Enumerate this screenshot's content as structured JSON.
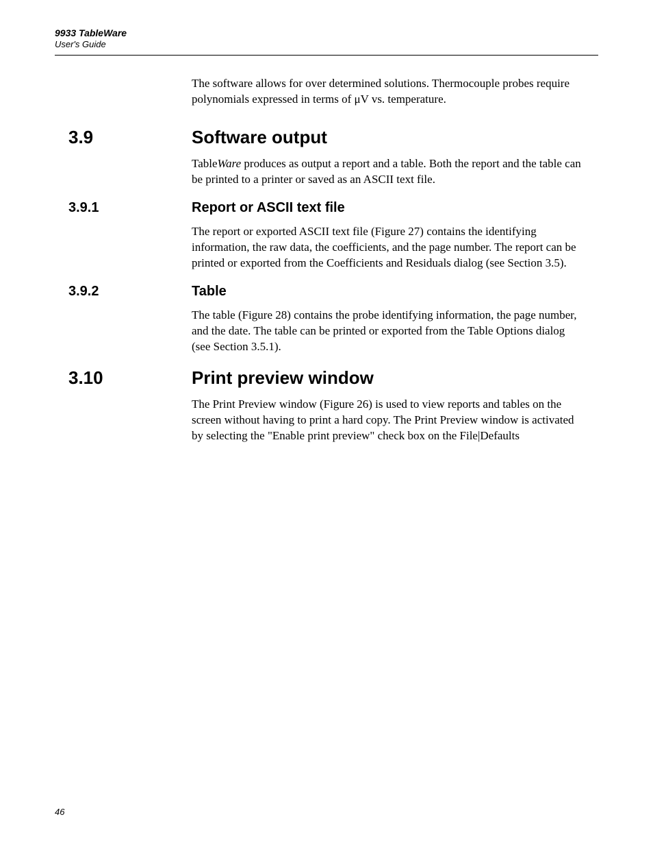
{
  "header": {
    "product": "9933 TableWare",
    "doctype": "User's Guide"
  },
  "intro": "The software allows for over determined solutions. Thermocouple probes require polynomials expressed in terms of μV vs. temperature.",
  "sections": {
    "s39": {
      "num": "3.9",
      "title": "Software output",
      "body_prefix": "Table",
      "body_italic": "Ware",
      "body_suffix": " produces as output a report and a table. Both the report and the table can be printed to a printer or saved as an ASCII text file."
    },
    "s391": {
      "num": "3.9.1",
      "title": "Report or ASCII text file",
      "body": "The report or exported ASCII text file (Figure 27) contains the identifying information, the raw data, the coefficients, and the page number. The report can be printed or exported from the Coefficients and Residuals dialog (see Section 3.5)."
    },
    "s392": {
      "num": "3.9.2",
      "title": "Table",
      "body": "The table (Figure 28) contains the probe identifying information, the page number, and the date. The table can be printed or exported from the Table Options dialog (see Section 3.5.1)."
    },
    "s310": {
      "num": "3.10",
      "title": "Print preview window",
      "body": "The Print Preview window (Figure 26) is used to view reports and tables on the screen without having to print a hard copy. The Print Preview window is activated by selecting the \"Enable print preview\" check box on the File|Defaults"
    }
  },
  "page_number": "46"
}
